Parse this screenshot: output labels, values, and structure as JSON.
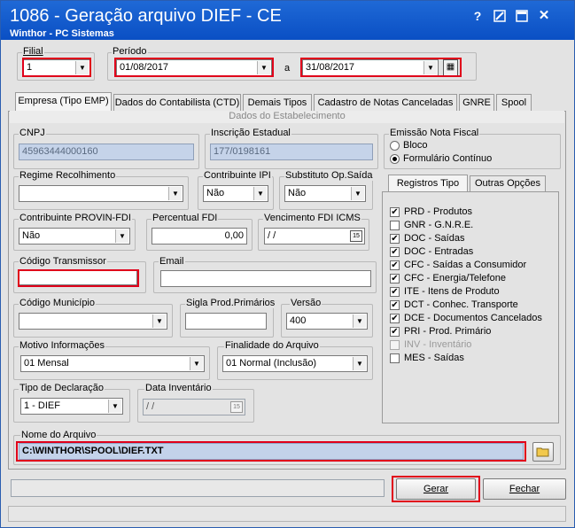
{
  "window": {
    "title": "1086 - Geração arquivo DIEF - CE",
    "subtitle": "Winthor - PC Sistemas",
    "help": "?",
    "close": "✕"
  },
  "filial": {
    "label": "Filial",
    "value": "1"
  },
  "periodo": {
    "label": "Período",
    "start": "01/08/2017",
    "separator": "a",
    "end": "31/08/2017"
  },
  "tabs": [
    "Empresa (Tipo EMP)",
    "Dados do Contabilista (CTD)",
    "Demais Tipos",
    "Cadastro de Notas Canceladas",
    "GNRE",
    "Spool"
  ],
  "section_title": "Dados do Estabelecimento",
  "cnpj": {
    "label": "CNPJ",
    "value": "45963444000160"
  },
  "inscricao": {
    "label": "Inscrição Estadual",
    "value": "177/0198161"
  },
  "emissao": {
    "label": "Emissão Nota Fiscal",
    "options": [
      "Bloco",
      "Formulário Contínuo"
    ]
  },
  "regime": {
    "label": "Regime Recolhimento",
    "value": ""
  },
  "contribuinte_ipi": {
    "label": "Contribuinte IPI",
    "value": "Não"
  },
  "substituto": {
    "label": "Substituto Op.Saída",
    "value": "Não"
  },
  "provin": {
    "label": "Contribuinte PROVIN-FDI",
    "value": "Não"
  },
  "percentual": {
    "label": "Percentual FDI",
    "value": "0,00"
  },
  "vencimento": {
    "label": "Vencimento FDI ICMS",
    "value": "/ /"
  },
  "codigo_transmissor": {
    "label": "Código Transmissor",
    "value": ""
  },
  "email": {
    "label": "Email",
    "value": ""
  },
  "codigo_municipio": {
    "label": "Código Município",
    "value": ""
  },
  "sigla": {
    "label": "Sigla Prod.Primários",
    "value": ""
  },
  "versao": {
    "label": "Versão",
    "value": "400"
  },
  "motivo": {
    "label": "Motivo Informações",
    "value": "01 Mensal"
  },
  "finalidade": {
    "label": "Finalidade do Arquivo",
    "value": "01 Normal (Inclusão)"
  },
  "tipo_declaracao": {
    "label": "Tipo de Declaração",
    "value": "1 - DIEF"
  },
  "data_inventario": {
    "label": "Data Inventário",
    "value": "/ /"
  },
  "right_tabs": [
    "Registros Tipo",
    "Outras Opções"
  ],
  "registros": [
    {
      "label": "PRD - Produtos",
      "checked": true,
      "disabled": false
    },
    {
      "label": "GNR - G.N.R.E.",
      "checked": false,
      "disabled": false
    },
    {
      "label": "DOC - Saídas",
      "checked": true,
      "disabled": false
    },
    {
      "label": "DOC - Entradas",
      "checked": true,
      "disabled": false
    },
    {
      "label": "CFC - Saídas a Consumidor",
      "checked": true,
      "disabled": false
    },
    {
      "label": "CFC - Energia/Telefone",
      "checked": true,
      "disabled": false
    },
    {
      "label": "ITE - Itens de Produto",
      "checked": true,
      "disabled": false
    },
    {
      "label": "DCT - Conhec. Transporte",
      "checked": true,
      "disabled": false
    },
    {
      "label": "DCE - Documentos Cancelados",
      "checked": true,
      "disabled": false
    },
    {
      "label": "PRI - Prod. Primário",
      "checked": true,
      "disabled": false
    },
    {
      "label": "INV - Inventário",
      "checked": false,
      "disabled": true
    },
    {
      "label": "MES - Saídas",
      "checked": false,
      "disabled": false
    }
  ],
  "nome_arquivo": {
    "label": "Nome do Arquivo",
    "value": "C:\\WINTHOR\\SPOOL\\DIEF.TXT"
  },
  "buttons": {
    "gerar": "Gerar",
    "fechar": "Fechar"
  }
}
